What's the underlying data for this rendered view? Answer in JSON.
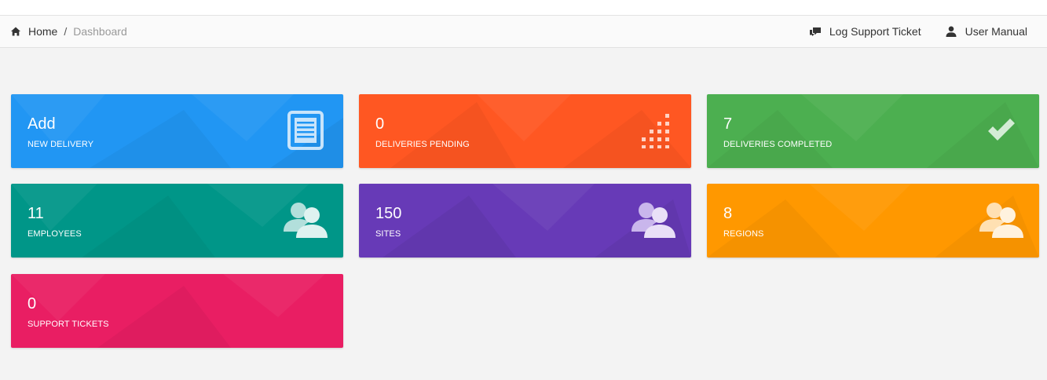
{
  "breadcrumb": {
    "home": "Home",
    "separator": "/",
    "current": "Dashboard"
  },
  "header_actions": [
    {
      "label": "Log Support Ticket",
      "icon": "chat-bubbles-icon"
    },
    {
      "label": "User Manual",
      "icon": "user-icon"
    }
  ],
  "tiles": [
    {
      "value": "Add",
      "label": "NEW DELIVERY",
      "color": "#2196F3",
      "icon": "document-icon"
    },
    {
      "value": "0",
      "label": "DELIVERIES PENDING",
      "color": "#FF5722",
      "icon": "bar-dots-icon"
    },
    {
      "value": "7",
      "label": "DELIVERIES COMPLETED",
      "color": "#4CAF50",
      "icon": "checkmark-icon"
    },
    {
      "value": "11",
      "label": "EMPLOYEES",
      "color": "#009688",
      "icon": "users-icon"
    },
    {
      "value": "150",
      "label": "SITES",
      "color": "#673AB7",
      "icon": "users-icon"
    },
    {
      "value": "8",
      "label": "REGIONS",
      "color": "#FF9800",
      "icon": "users-icon"
    },
    {
      "value": "0",
      "label": "SUPPORT TICKETS",
      "color": "#E91E63",
      "icon": ""
    }
  ]
}
